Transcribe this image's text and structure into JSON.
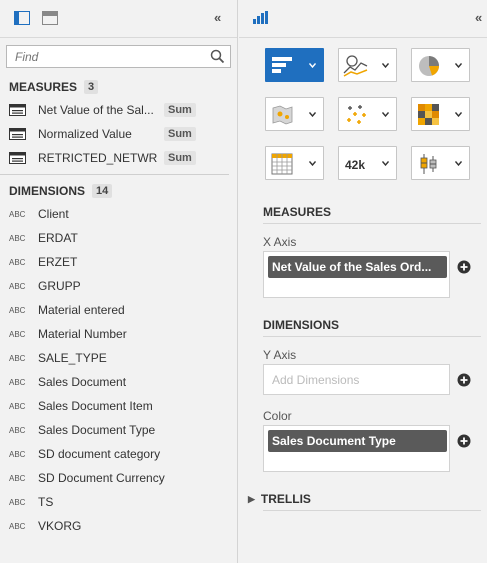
{
  "left_panel": {
    "search": {
      "placeholder": "Find"
    },
    "measures": {
      "title": "MEASURES",
      "count": "3",
      "items": [
        {
          "label": "Net Value of the Sal...",
          "agg": "Sum"
        },
        {
          "label": "Normalized Value",
          "agg": "Sum"
        },
        {
          "label": "RETRICTED_NETWR",
          "agg": "Sum"
        }
      ]
    },
    "dimensions": {
      "title": "DIMENSIONS",
      "count": "14",
      "type_tag": "ABC",
      "items": [
        "Client",
        "ERDAT",
        "ERZET",
        "GRUPP",
        "Material entered",
        "Material Number",
        "SALE_TYPE",
        "Sales Document",
        "Sales Document Item",
        "Sales Document Type",
        "SD document category",
        "SD Document Currency",
        "TS",
        "VKORG"
      ]
    }
  },
  "right_panel": {
    "chart_types": [
      {
        "name": "bar-chart",
        "selected": true
      },
      {
        "name": "line-chart",
        "selected": false
      },
      {
        "name": "pie-chart",
        "selected": false
      },
      {
        "name": "geo-map",
        "selected": false
      },
      {
        "name": "scatter-chart",
        "selected": false
      },
      {
        "name": "heatmap",
        "selected": false
      },
      {
        "name": "table",
        "selected": false
      },
      {
        "name": "numeric-point",
        "selected": false,
        "label": "42k"
      },
      {
        "name": "box-plot",
        "selected": false
      }
    ],
    "measures": {
      "title": "MEASURES",
      "x_axis": {
        "label": "X Axis",
        "pill": "Net Value of the Sales Ord..."
      }
    },
    "dimensions": {
      "title": "DIMENSIONS",
      "y_axis": {
        "label": "Y Axis",
        "placeholder": "Add Dimensions"
      },
      "color": {
        "label": "Color",
        "pill": "Sales Document Type"
      }
    },
    "trellis": {
      "title": "TRELLIS"
    }
  },
  "colors": {
    "accent": "#1f6fbf",
    "pill": "#5a5a5a",
    "orange": "#f0a500"
  }
}
